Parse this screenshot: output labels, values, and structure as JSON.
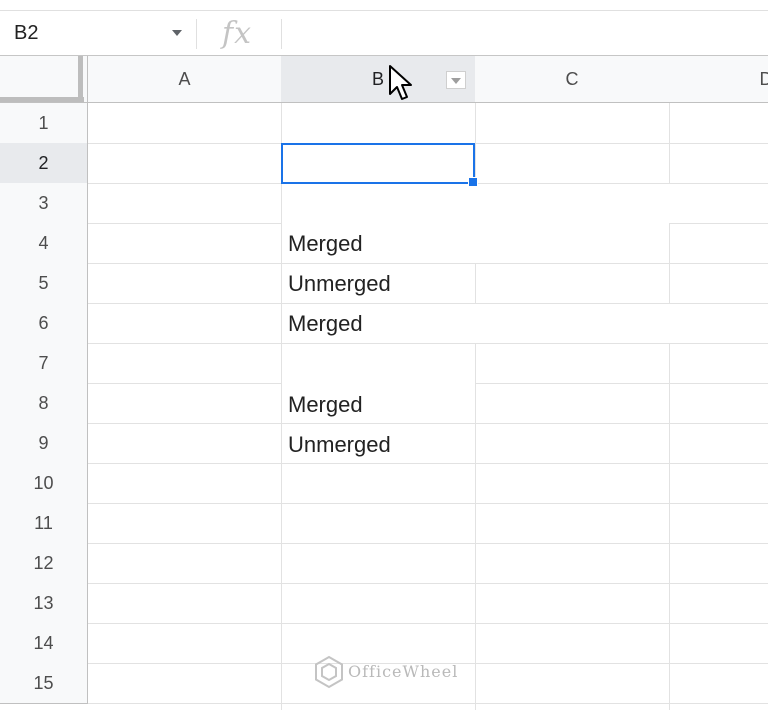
{
  "formula_bar": {
    "name_box": "B2",
    "fx_label": "fx",
    "formula": ""
  },
  "columns": [
    "A",
    "B",
    "C",
    "D"
  ],
  "rows": [
    "1",
    "2",
    "3",
    "4",
    "5",
    "6",
    "7",
    "8",
    "9",
    "10",
    "11",
    "12",
    "13",
    "14",
    "15"
  ],
  "selection": {
    "active_cell": "B2",
    "selected_column": "B",
    "selected_row": "2"
  },
  "cells": {
    "B4": "Merged",
    "B5": "Unmerged",
    "B6": "Merged",
    "B8": "Merged",
    "B9": "Unmerged"
  },
  "watermark": "OfficeWheel",
  "colors": {
    "selection": "#1a73e8",
    "header_bg": "#f8f9fa",
    "header_selected_bg": "#e8eaed",
    "gridline": "#e2e2e2"
  },
  "icons": {
    "name_box_dropdown": "chevron-down-icon",
    "column_filter": "filter-dropdown-icon",
    "cursor": "mouse-pointer-icon",
    "watermark_logo": "officewheel-logo-icon"
  }
}
